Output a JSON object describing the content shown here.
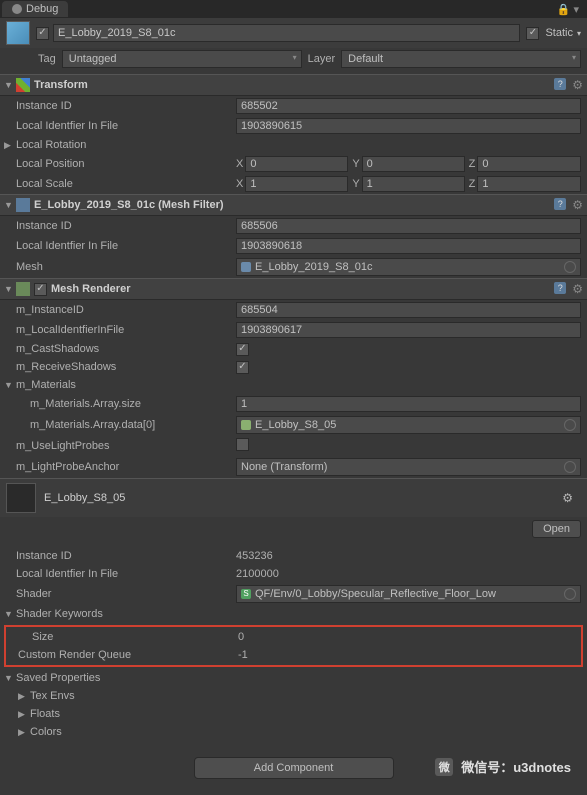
{
  "tab": {
    "label": "Debug"
  },
  "header": {
    "name": "E_Lobby_2019_S8_01c",
    "enabled": true,
    "static_label": "Static",
    "static": true,
    "tag_label": "Tag",
    "tag_value": "Untagged",
    "layer_label": "Layer",
    "layer_value": "Default"
  },
  "transform": {
    "title": "Transform",
    "instance_id_label": "Instance ID",
    "instance_id": "685502",
    "local_id_label": "Local Identfier In File",
    "local_id": "1903890615",
    "local_rotation_label": "Local Rotation",
    "local_position_label": "Local Position",
    "pos": {
      "x": "0",
      "y": "0",
      "z": "0"
    },
    "local_scale_label": "Local Scale",
    "scale": {
      "x": "1",
      "y": "1",
      "z": "1"
    }
  },
  "mesh_filter": {
    "title": "E_Lobby_2019_S8_01c (Mesh Filter)",
    "instance_id_label": "Instance ID",
    "instance_id": "685506",
    "local_id_label": "Local Identfier In File",
    "local_id": "1903890618",
    "mesh_label": "Mesh",
    "mesh_value": "E_Lobby_2019_S8_01c"
  },
  "mesh_renderer": {
    "title": "Mesh Renderer",
    "enabled": true,
    "instance_id_label": "m_InstanceID",
    "instance_id": "685504",
    "local_id_label": "m_LocalIdentfierInFile",
    "local_id": "1903890617",
    "cast_shadows_label": "m_CastShadows",
    "cast_shadows": true,
    "receive_shadows_label": "m_ReceiveShadows",
    "receive_shadows": true,
    "materials_label": "m_Materials",
    "mat_size_label": "m_Materials.Array.size",
    "mat_size": "1",
    "mat_data0_label": "m_Materials.Array.data[0]",
    "mat_data0_value": "E_Lobby_S8_05",
    "use_lightprobes_label": "m_UseLightProbes",
    "use_lightprobes": false,
    "anchor_label": "m_LightProbeAnchor",
    "anchor_value": "None (Transform)"
  },
  "material": {
    "name": "E_Lobby_S8_05",
    "open_label": "Open",
    "instance_id_label": "Instance ID",
    "instance_id": "453236",
    "local_id_label": "Local Identfier In File",
    "local_id": "2100000",
    "shader_label": "Shader",
    "shader_value": "QF/Env/0_Lobby/Specular_Reflective_Floor_Low",
    "keywords_label": "Shader Keywords",
    "size_label": "Size",
    "size_value": "0",
    "crq_label": "Custom Render Queue",
    "crq_value": "-1",
    "saved_label": "Saved Properties",
    "texenvs_label": "Tex Envs",
    "floats_label": "Floats",
    "colors_label": "Colors"
  },
  "add_component_label": "Add Component",
  "watermark": {
    "label": "微信号：u3dnotes"
  }
}
